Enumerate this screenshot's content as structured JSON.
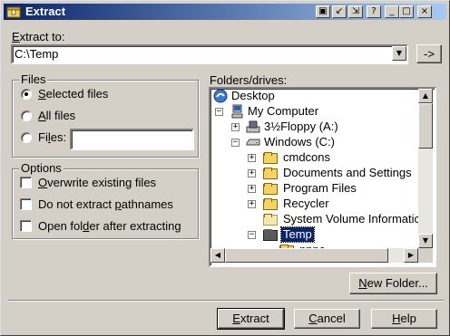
{
  "window": {
    "title": "Extract",
    "title_buttons": [
      "▣",
      "↙",
      "⇲",
      "?",
      "_",
      "□",
      "×"
    ]
  },
  "extract_to": {
    "label": "Extract to:",
    "label_underline": "E",
    "label_rest": "xtract to:",
    "value": "C:\\Temp",
    "arrow_button": "->"
  },
  "files_group": {
    "title": "Files",
    "options": [
      {
        "u": "S",
        "rest": "elected files",
        "selected": true
      },
      {
        "u": "A",
        "rest": "ll files",
        "selected": false
      },
      {
        "pre": "Fi",
        "u": "l",
        "rest": "es:",
        "selected": false
      }
    ],
    "files_input": ""
  },
  "options_group": {
    "title": "Options",
    "items": [
      {
        "u": "O",
        "rest": "verwrite existing files",
        "checked": false
      },
      {
        "pre": "Do not extract ",
        "u": "p",
        "rest": "athnames",
        "checked": false
      },
      {
        "pre": "Open fol",
        "u": "d",
        "rest": "er after extracting",
        "checked": false
      }
    ]
  },
  "folders": {
    "label": "Folders/drives:",
    "tree": [
      {
        "label": "Desktop",
        "icon": "desktop-icon"
      },
      {
        "label": "My Computer",
        "icon": "computer-icon",
        "expander": "−"
      },
      {
        "label": "3½Floppy (A:)",
        "icon": "floppy-drive-icon",
        "expander": "+"
      },
      {
        "label": "Windows (C:)",
        "icon": "hard-drive-icon",
        "expander": "−"
      },
      {
        "label": "cmdcons",
        "icon": "folder-icon",
        "expander": "+"
      },
      {
        "label": "Documents and Settings",
        "icon": "folder-icon",
        "expander": "+"
      },
      {
        "label": "Program Files",
        "icon": "folder-icon",
        "expander": "+"
      },
      {
        "label": "Recycler",
        "icon": "folder-icon",
        "expander": "+"
      },
      {
        "label": "System Volume Informatic",
        "icon": "folder-icon"
      },
      {
        "label": "Temp",
        "icon": "folder-open-icon",
        "expander": "−",
        "selected": true
      },
      {
        "label": "pppc",
        "icon": "folder-icon"
      }
    ]
  },
  "buttons": {
    "new_folder": {
      "u": "N",
      "rest": "ew Folder..."
    },
    "extract": {
      "u": "E",
      "rest": "xtract"
    },
    "cancel": {
      "u": "C",
      "rest": "ancel"
    },
    "help": {
      "u": "H",
      "rest": "elp"
    }
  },
  "colors": {
    "titlebar_start": "#0a246a",
    "titlebar_end": "#a6caf0",
    "face": "#d4d0c8",
    "selection": "#0a246a"
  }
}
